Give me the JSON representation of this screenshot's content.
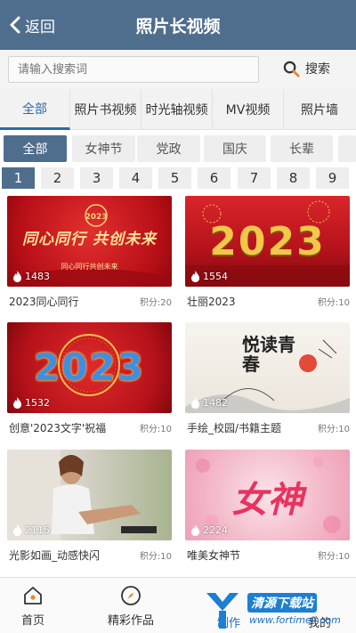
{
  "header": {
    "back_label": "返回",
    "title": "照片长视频"
  },
  "search": {
    "placeholder": "请输入搜索词",
    "button_label": "搜索"
  },
  "category_tabs": [
    "全部",
    "照片书视频",
    "时光轴视频",
    "MV视频",
    "照片墙"
  ],
  "sub_tabs": [
    "全部",
    "女神节",
    "党政",
    "国庆",
    "长辈"
  ],
  "pages": [
    "1",
    "2",
    "3",
    "4",
    "5",
    "6",
    "7",
    "8",
    "9"
  ],
  "cards": [
    {
      "title": "2023同心同行",
      "points": "积分:20",
      "views": "1483",
      "thumb_text": "同心同行 共创未来",
      "thumb_sub": "同心同行共创未来"
    },
    {
      "title": "壮丽2023",
      "points": "积分:10",
      "views": "1554",
      "thumb_text": "2023"
    },
    {
      "title": "创意'2023文字'祝福",
      "points": "积分:10",
      "views": "1532",
      "thumb_text": "2023"
    },
    {
      "title": "手绘_校园/书籍主题",
      "points": "积分:10",
      "views": "1482",
      "thumb_text": "悦读青春"
    },
    {
      "title": "光影如画_动感快闪",
      "points": "积分:10",
      "views": "2115"
    },
    {
      "title": "唯美女神节",
      "points": "积分:10",
      "views": "2224",
      "thumb_text": "女神"
    }
  ],
  "bottom_nav": {
    "home": "首页",
    "featured": "精彩作品",
    "create": "制作",
    "mine": "我的"
  },
  "watermark": {
    "text": "清源下载站",
    "url": "www.fortimeli.com"
  },
  "colors": {
    "accent": "#4f6e8d",
    "tab_active": "#2b6aa8",
    "festive_red": "#c8141c"
  }
}
